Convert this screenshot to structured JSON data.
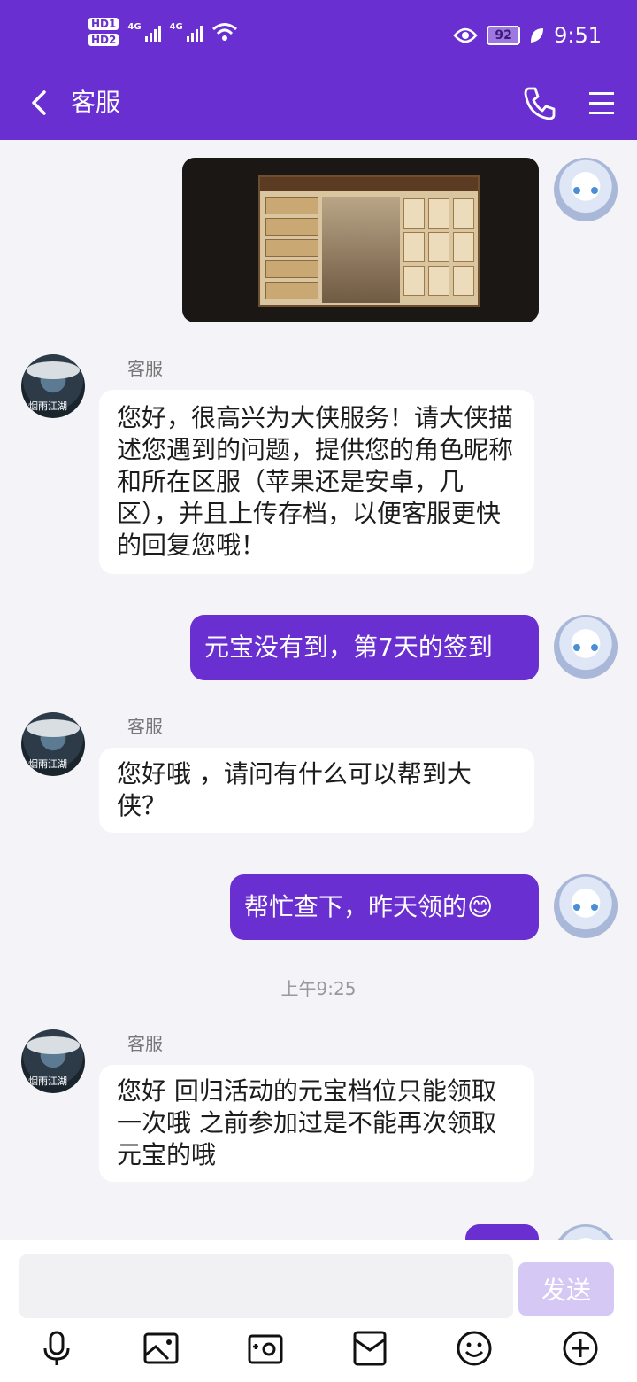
{
  "status_bar": {
    "hd1": "HD1",
    "hd2": "HD2",
    "net1": "4G",
    "net2": "4G",
    "battery": "92",
    "time": "9:51"
  },
  "header": {
    "title": "客服",
    "icons": [
      "back-icon",
      "phone-icon",
      "menu-icon"
    ]
  },
  "messages": [
    {
      "type": "image",
      "from": "user"
    },
    {
      "from": "agent",
      "sender": "客服",
      "text": "您好，很高兴为大侠服务！请大侠描述您遇到的问题，提供您的角色昵称和所在区服（苹果还是安卓，几区），并且上传存档，以便客服更快的回复您哦！"
    },
    {
      "from": "user",
      "text": "元宝没有到，第7天的签到"
    },
    {
      "from": "agent",
      "sender": "客服",
      "text": "您好哦 ，请问有什么可以帮到大侠？"
    },
    {
      "from": "user",
      "text": "帮忙查下，昨天领的",
      "emoji": "😊"
    },
    {
      "type": "time",
      "text": "上午9:25"
    },
    {
      "from": "agent",
      "sender": "客服",
      "text": "您好  回归活动的元宝档位只能领取一次哦 之前参加过是不能再次领取元宝的哦"
    }
  ],
  "agent_avatar_tag": "烟雨江湖",
  "composer": {
    "input_value": "",
    "send_label": "发送",
    "tools": [
      "microphone-icon",
      "image-icon",
      "camera-icon",
      "box-icon",
      "emoji-icon",
      "plus-icon"
    ]
  },
  "colors": {
    "brand": "#6a2fd1",
    "send_disabled": "#d6c8f4",
    "chat_bg": "#f3f3f8"
  }
}
